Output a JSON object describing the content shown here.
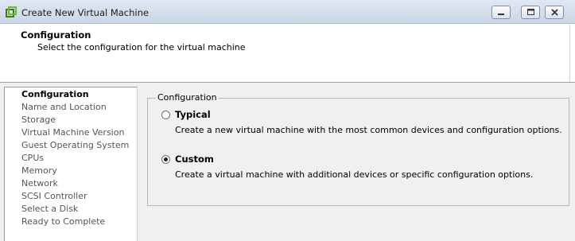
{
  "window": {
    "title": "Create New Virtual Machine"
  },
  "header": {
    "title": "Configuration",
    "subtitle": "Select the configuration for the virtual machine"
  },
  "steps": [
    {
      "label": "Configuration",
      "active": true
    },
    {
      "label": "Name and Location"
    },
    {
      "label": "Storage"
    },
    {
      "label": "Virtual Machine Version"
    },
    {
      "label": "Guest Operating System"
    },
    {
      "label": "CPUs"
    },
    {
      "label": "Memory"
    },
    {
      "label": "Network"
    },
    {
      "label": "SCSI Controller"
    },
    {
      "label": "Select a Disk"
    },
    {
      "label": "Ready to Complete"
    }
  ],
  "configuration": {
    "legend": "Configuration",
    "options": [
      {
        "label": "Typical",
        "description": "Create a new virtual machine with the most common devices and configuration options.",
        "selected": false
      },
      {
        "label": "Custom",
        "description": "Create a virtual machine with additional devices or specific configuration options.",
        "selected": true
      }
    ]
  },
  "icons": {
    "app": "vm-app-icon",
    "minimize": "minimize-icon",
    "maximize": "maximize-icon",
    "close": "close-icon"
  }
}
